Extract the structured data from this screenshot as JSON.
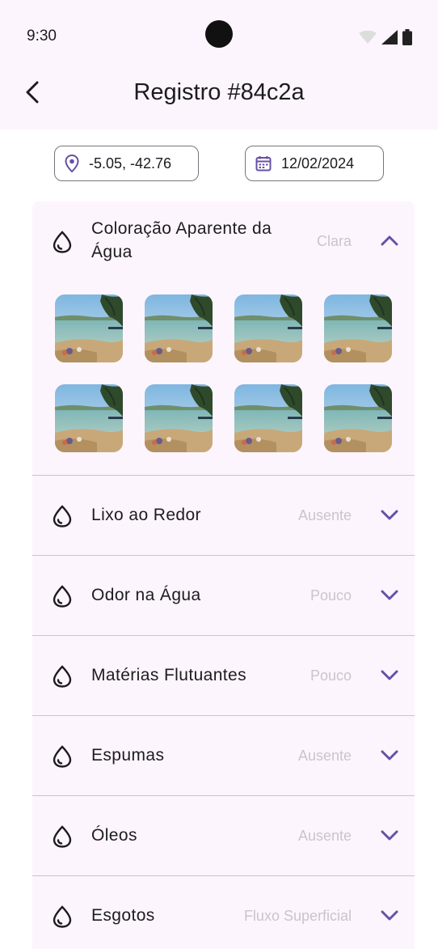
{
  "status": {
    "time": "9:30"
  },
  "header": {
    "title": "Registro #84c2a"
  },
  "chips": {
    "location": "-5.05, -42.76",
    "date": "12/02/2024"
  },
  "accent_color": "#6750a4",
  "sections": [
    {
      "title": "Coloração Aparente da Água",
      "value": "Clara",
      "expanded": true,
      "photo_count": 8
    },
    {
      "title": "Lixo ao Redor",
      "value": "Ausente",
      "expanded": false
    },
    {
      "title": "Odor na Água",
      "value": "Pouco",
      "expanded": false
    },
    {
      "title": "Matérias Flutuantes",
      "value": "Pouco",
      "expanded": false
    },
    {
      "title": "Espumas",
      "value": "Ausente",
      "expanded": false
    },
    {
      "title": "Óleos",
      "value": "Ausente",
      "expanded": false
    },
    {
      "title": "Esgotos",
      "value": "Fluxo Superficial",
      "expanded": false
    }
  ],
  "icons": {
    "section": "water-drop-icon",
    "back": "arrow-back-icon",
    "location": "location-pin-icon",
    "date": "calendar-icon"
  }
}
